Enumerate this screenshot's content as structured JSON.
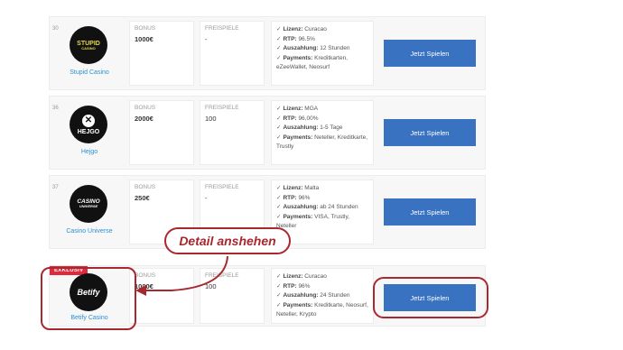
{
  "labels": {
    "bonus": "BONUS",
    "freispiele": "FREISPIELE",
    "button": "Jetzt Spielen",
    "exklusiv": "EXKLUSIV"
  },
  "callout": "Detail anshehen",
  "casinos": [
    {
      "rank": "30",
      "name": "Stupid Casino",
      "logo_text": "STUPID",
      "logo_sub": "CASINO",
      "bonus": "1000€",
      "freispiele": "-",
      "info": [
        {
          "key": "Lizenz:",
          "value": "Curacao"
        },
        {
          "key": "RTP:",
          "value": "96.5%"
        },
        {
          "key": "Auszahlung:",
          "value": "12 Stunden"
        },
        {
          "key": "Payments:",
          "value": "Kreditkarten, eZeeWallet, Neosurf"
        }
      ]
    },
    {
      "rank": "36",
      "name": "Hejgo",
      "logo_text": "HEJGO",
      "logo_sub": "",
      "bonus": "2000€",
      "freispiele": "100",
      "info": [
        {
          "key": "Lizenz:",
          "value": "MGA"
        },
        {
          "key": "RTP:",
          "value": "96,00%"
        },
        {
          "key": "Auszahlung:",
          "value": "1-5 Tage"
        },
        {
          "key": "Payments:",
          "value": "Neteller, Kreditkarte, Trustly"
        }
      ]
    },
    {
      "rank": "37",
      "name": "Casino Universe",
      "logo_text": "CASINO",
      "logo_sub": "UNIVERSE",
      "bonus": "250€",
      "freispiele": "-",
      "info": [
        {
          "key": "Lizenz:",
          "value": "Malta"
        },
        {
          "key": "RTP:",
          "value": "96%"
        },
        {
          "key": "Auszahlung:",
          "value": "ab 24 Stunden"
        },
        {
          "key": "Payments:",
          "value": "VISA, Trustly, Neteller"
        }
      ]
    },
    {
      "rank": "",
      "name": "Betify Casino",
      "logo_text": "Betify",
      "logo_sub": "",
      "bonus": "1000€",
      "freispiele": "100",
      "info": [
        {
          "key": "Lizenz:",
          "value": "Curacao"
        },
        {
          "key": "RTP:",
          "value": "96%"
        },
        {
          "key": "Auszahlung:",
          "value": "24 Stunden"
        },
        {
          "key": "Payments:",
          "value": "Kreditkarte, Neosurf, Neteller, Krypto"
        }
      ]
    }
  ],
  "colors": {
    "button": "#3a72c2",
    "annotation": "#a8282f",
    "exklusiv": "#e02a3b",
    "casino_name": "#2c8fd0"
  }
}
